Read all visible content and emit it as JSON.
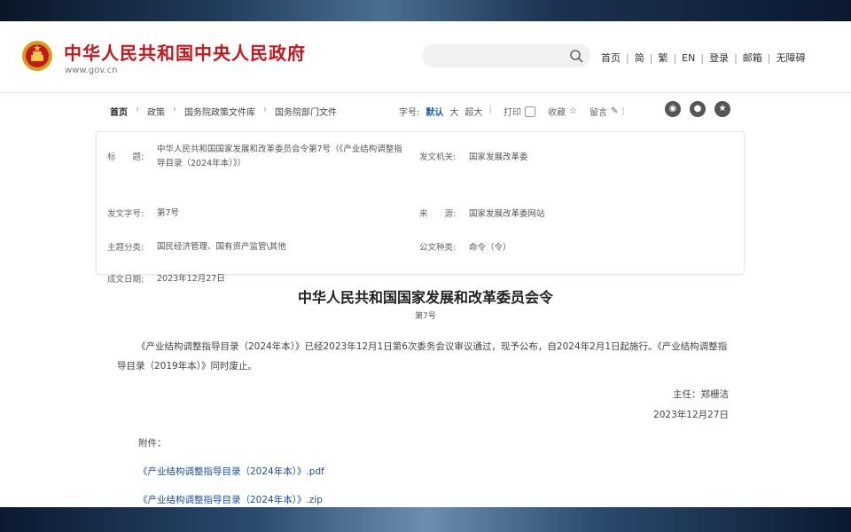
{
  "header": {
    "site_title": "中华人民共和国中央人民政府",
    "site_domain": "www.gov.cn",
    "top_links": [
      "首页",
      "简",
      "繁",
      "EN",
      "登录",
      "邮箱",
      "无障碍"
    ]
  },
  "breadcrumb": [
    "首页",
    "政策",
    "国务院政策文件库",
    "国务院部门文件"
  ],
  "toolbar": {
    "font_size_label": "字号:",
    "font_default": "默认",
    "font_large": "大",
    "font_xlarge": "超大",
    "print": "打印",
    "favorite": "收藏",
    "message": "留言"
  },
  "info": {
    "title_label": "标　　题:",
    "title_value": "中华人民共和国国家发展和改革委员会令第7号（《产业结构调整指导目录（2024年本）》）",
    "issuer_label": "发文机关:",
    "issuer_value": "国家发展改革委",
    "doc_no_label": "发文字号:",
    "doc_no_value": "第7号",
    "source_label": "来　　源:",
    "source_value": "国家发展改革委网站",
    "category_label": "主题分类:",
    "category_value": "国民经济管理、国有资产监管\\其他",
    "type_label": "公文种类:",
    "type_value": "命令（令）",
    "date_label": "成文日期:",
    "date_value": "2023年12月27日"
  },
  "document": {
    "title": "中华人民共和国国家发展和改革委员会令",
    "number": "第7号",
    "body": "《产业结构调整指导目录（2024年本）》已经2023年12月1日第6次委务会议审议通过，现予公布，自2024年2月1日起施行。《产业结构调整指导目录（2019年本）》同时废止。",
    "signer": "主任：郑栅洁",
    "date": "2023年12月27日",
    "attachments_label": "附件：",
    "attachments": [
      "《产业结构调整指导目录（2024年本）》.pdf",
      "《产业结构调整指导目录（2024年本）》.zip"
    ]
  }
}
